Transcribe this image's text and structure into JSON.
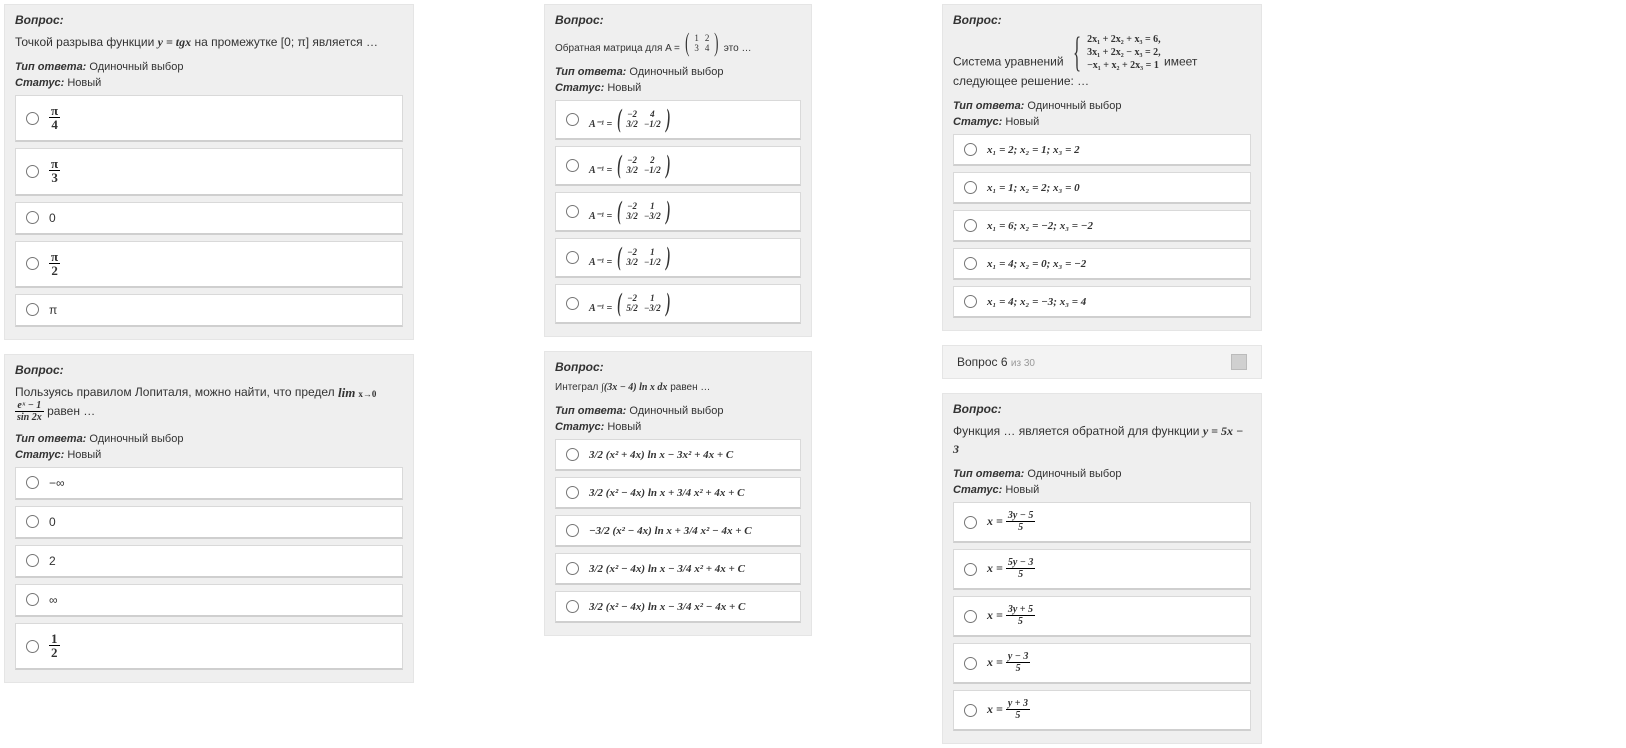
{
  "labels": {
    "question": "Вопрос:",
    "answer_type_lbl": "Тип ответа:",
    "answer_type_val": "Одиночный выбор",
    "status_lbl": "Статус:",
    "status_val": "Новый"
  },
  "col1": {
    "q1": {
      "pre": "Точкой разрыва функции ",
      "formula": "y = tgx",
      "post": " на промежутке [0; π] является …",
      "opts": [
        "π / 4",
        "π / 3",
        "0",
        "π / 2",
        "π"
      ]
    },
    "q2": {
      "pre": "Пользуясь правилом Лопиталя, можно найти, что предел ",
      "lim_top": "lim",
      "lim_bot": "x→0",
      "frac_top": "eˣ − 1",
      "frac_bot": "sin 2x",
      "post": " равен …",
      "opts": [
        "−∞",
        "0",
        "2",
        "∞",
        "1 / 2"
      ]
    }
  },
  "col2": {
    "q1": {
      "pre": "Обратная матрица для A = ",
      "mat": [
        [
          "1",
          "2"
        ],
        [
          "3",
          "4"
        ]
      ],
      "post": " это …",
      "opts": [
        {
          "lead": "A⁻¹ =",
          "rows": [
            [
              "−2",
              "4"
            ],
            [
              "3/2",
              "−1/2"
            ]
          ]
        },
        {
          "lead": "A⁻¹ =",
          "rows": [
            [
              "−2",
              "2"
            ],
            [
              "3/2",
              "−1/2"
            ]
          ]
        },
        {
          "lead": "A⁻¹ =",
          "rows": [
            [
              "−2",
              "1"
            ],
            [
              "3/2",
              "−3/2"
            ]
          ]
        },
        {
          "lead": "A⁻¹ =",
          "rows": [
            [
              "−2",
              "1"
            ],
            [
              "3/2",
              "−1/2"
            ]
          ]
        },
        {
          "lead": "A⁻¹ =",
          "rows": [
            [
              "−2",
              "1"
            ],
            [
              "5/2",
              "−3/2"
            ]
          ]
        }
      ]
    },
    "q2": {
      "pre": "Интеграл ",
      "formula": "∫(3x − 4) ln x dx",
      "post": " равен …",
      "opts": [
        "3/2 (x² + 4x) ln x − 3x² + 4x + C",
        "3/2 (x² − 4x) ln x + 3/4 x² + 4x + C",
        "−3/2 (x² − 4x) ln x + 3/4 x² − 4x + C",
        "3/2 (x² − 4x) ln x − 3/4 x² + 4x + C",
        "3/2 (x² − 4x) ln x − 3/4 x² − 4x + C"
      ]
    }
  },
  "col3": {
    "q1": {
      "pre": "Система уравнений ",
      "sys": [
        "2x₁ + 2x₂ + x₃ = 6,",
        "3x₁ + 2x₂ − x₃ = 2,",
        "−x₁ + x₂ + 2x₃ = 1"
      ],
      "post": " имеет следующее решение: …",
      "opts": [
        "x₁ = 2;  x₂ = 1;  x₃ = 2",
        "x₁ = 1;  x₂ = 2;  x₃ = 0",
        "x₁ = 6;  x₂ = −2;  x₃ = −2",
        "x₁ = 4;  x₂ = 0;  x₃ = −2",
        "x₁ = 4;  x₂ = −3;  x₃ = 4"
      ]
    },
    "nav": {
      "title": "Вопрос 6",
      "sub": " из 30"
    },
    "q2": {
      "pre": "Функция … является обратной для функции ",
      "formula": "y = 5x − 3",
      "opts": [
        {
          "lhs": "x =",
          "num": "3y − 5",
          "den": "5"
        },
        {
          "lhs": "x =",
          "num": "5y − 3",
          "den": "5"
        },
        {
          "lhs": "x =",
          "num": "3y + 5",
          "den": "5"
        },
        {
          "lhs": "x =",
          "num": "y − 3",
          "den": "5"
        },
        {
          "lhs": "x =",
          "num": "y + 3",
          "den": "5"
        }
      ]
    }
  }
}
